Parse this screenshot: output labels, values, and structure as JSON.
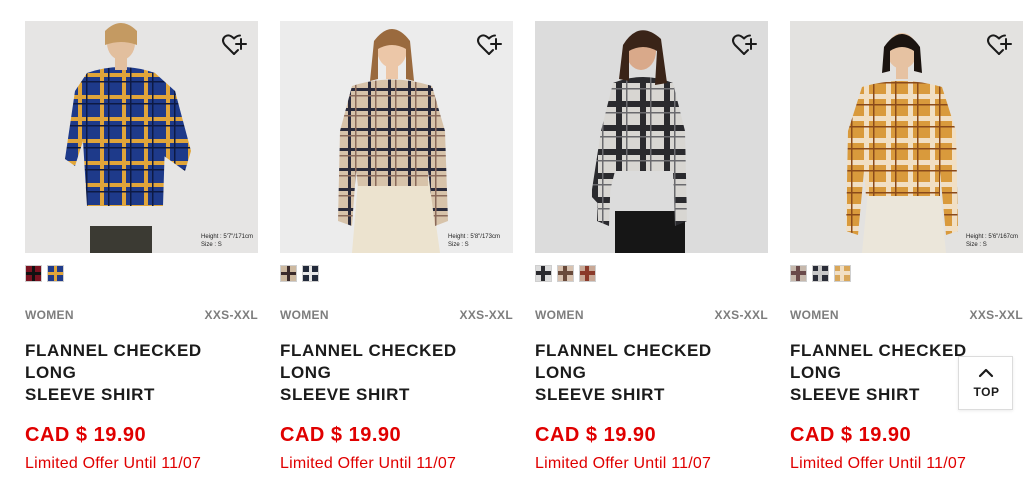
{
  "products": [
    {
      "category": "WOMEN",
      "size_range": "XXS-XXL",
      "name_line1": "FLANNEL CHECKED LONG",
      "name_line2": "SLEEVE SHIRT",
      "price": "CAD $ 19.90",
      "offer": "Limited Offer Until 11/07",
      "model_height": "Height : 5'7\"/171cm",
      "model_size": "Size : S",
      "swatch_colors": [
        "#7a1220",
        "#1f3b8a"
      ]
    },
    {
      "category": "WOMEN",
      "size_range": "XXS-XXL",
      "name_line1": "FLANNEL CHECKED LONG",
      "name_line2": "SLEEVE SHIRT",
      "price": "CAD $ 19.90",
      "offer": "Limited Offer Until 11/07",
      "model_height": "Height : 5'8\"/173cm",
      "model_size": "Size : S",
      "swatch_colors": [
        "#cdb9a0",
        "#222a3a"
      ]
    },
    {
      "category": "WOMEN",
      "size_range": "XXS-XXL",
      "name_line1": "FLANNEL CHECKED LONG",
      "name_line2": "SLEEVE SHIRT",
      "price": "CAD $ 19.90",
      "offer": "Limited Offer Until 11/07",
      "swatch_colors": [
        "#3a3a3a",
        "#8a6a58",
        "#8a3a2a"
      ]
    },
    {
      "category": "WOMEN",
      "size_range": "XXS-XXL",
      "name_line1": "FLANNEL CHECKED LONG",
      "name_line2": "SLEEVE SHIRT",
      "price": "CAD $ 19.90",
      "offer": "Limited Offer Until 11/07",
      "model_height": "Height : 5'6\"/167cm",
      "model_size": "Size : S",
      "swatch_colors": [
        "#b8a89a",
        "#2a2d38",
        "#d9a75a"
      ]
    }
  ],
  "top_button": {
    "label": "TOP",
    "icon": "chevron-up-icon"
  },
  "wishlist_icon": "heart-plus-icon",
  "colors": {
    "price_red": "#e00000",
    "meta_gray": "#7d7d7d",
    "text_dark": "#1b1b1b"
  }
}
